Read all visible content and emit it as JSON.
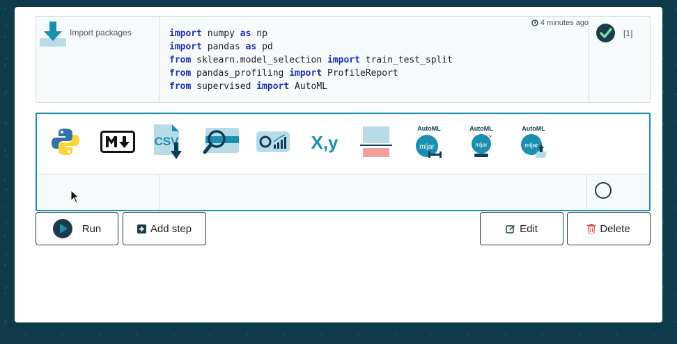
{
  "completed_cell": {
    "step_name": "Import packages",
    "timestamp": "4 minutes ago",
    "exec_count": "[1]",
    "code_lines": [
      [
        {
          "t": "import",
          "k": true
        },
        {
          "t": " numpy "
        },
        {
          "t": "as",
          "k": true
        },
        {
          "t": " np"
        }
      ],
      [
        {
          "t": "import",
          "k": true
        },
        {
          "t": " pandas "
        },
        {
          "t": "as",
          "k": true
        },
        {
          "t": " pd"
        }
      ],
      [
        {
          "t": "from",
          "k": true
        },
        {
          "t": " sklearn.model_selection "
        },
        {
          "t": "import",
          "k": true
        },
        {
          "t": " train_test_split"
        }
      ],
      [
        {
          "t": "from",
          "k": true
        },
        {
          "t": " pandas_profiling "
        },
        {
          "t": "import",
          "k": true
        },
        {
          "t": " ProfileReport"
        }
      ],
      [
        {
          "t": "from",
          "k": true
        },
        {
          "t": " supervised "
        },
        {
          "t": "import",
          "k": true
        },
        {
          "t": " AutoML"
        }
      ]
    ]
  },
  "palette": {
    "tools": [
      {
        "name": "python-icon"
      },
      {
        "name": "markdown-icon"
      },
      {
        "name": "csv-download-icon",
        "label": "CSV"
      },
      {
        "name": "search-data-icon"
      },
      {
        "name": "data-profile-icon"
      },
      {
        "name": "xy-split-icon",
        "label": "X,y"
      },
      {
        "name": "train-test-split-icon"
      },
      {
        "name": "automl-train-icon",
        "label": "AutoML",
        "sub": "mljar"
      },
      {
        "name": "automl-predict-icon",
        "label": "AutoML",
        "sub": "mljar"
      },
      {
        "name": "automl-load-icon",
        "label": "AutoML",
        "sub": "mljar"
      }
    ]
  },
  "buttons": {
    "run": "Run",
    "add_step": "Add step",
    "edit": "Edit",
    "delete": "Delete"
  },
  "colors": {
    "accent": "#1a8fb0",
    "dark": "#1b3a4a",
    "keyword": "#1a2fb0",
    "delete_icon": "#d9534f"
  }
}
